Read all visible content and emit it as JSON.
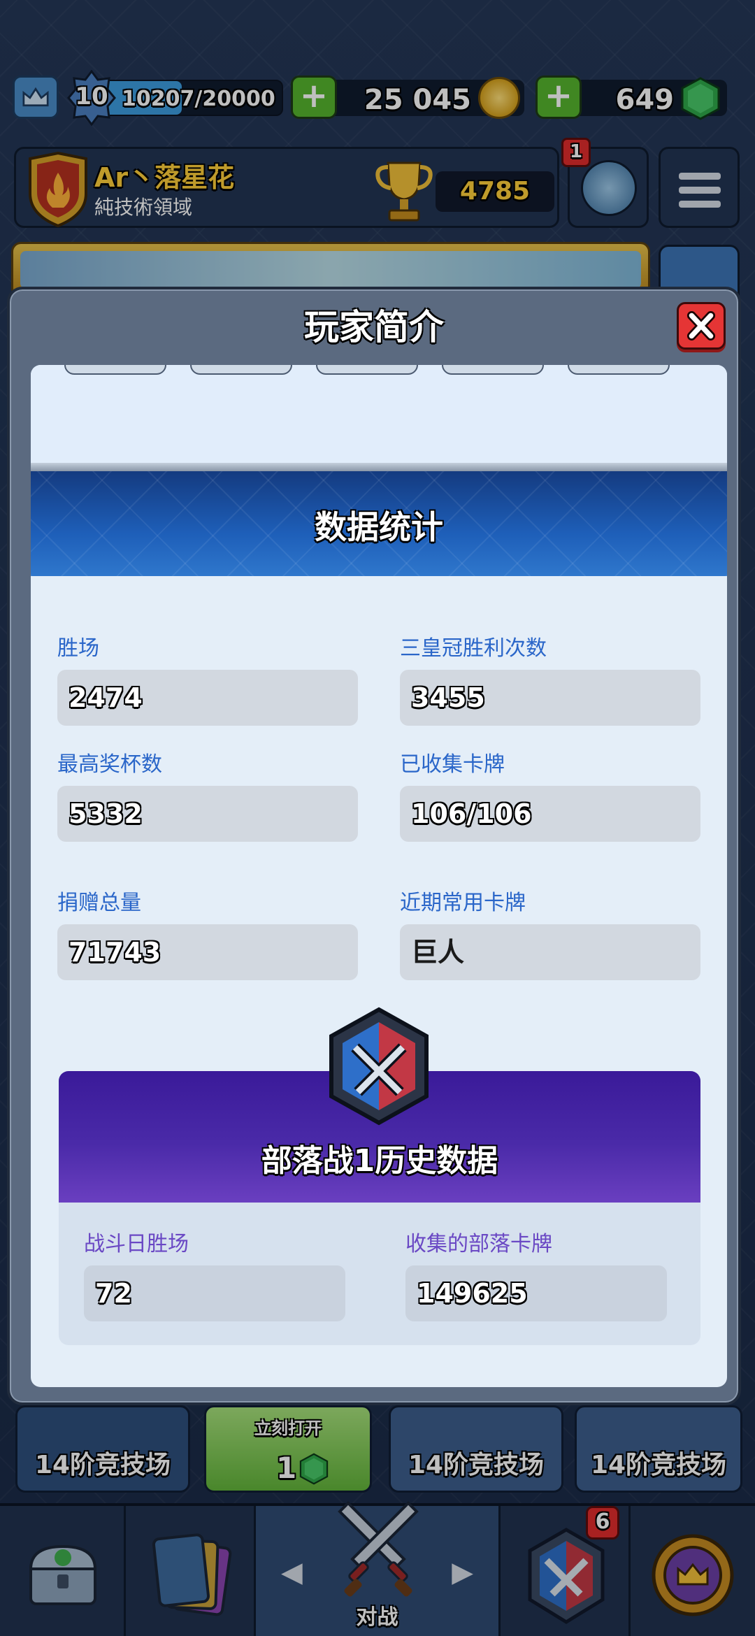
{
  "topbar": {
    "level": "10",
    "xp": "10207/20000",
    "xp_progress": 0.51,
    "gold": "25 045",
    "gems": "649",
    "plus_label": "+"
  },
  "profile": {
    "name_prefix": "Ar丶",
    "name": "落星花",
    "clan": "純技術領域",
    "trophies": "4785",
    "friends_badge": "1"
  },
  "modal": {
    "title": "玩家简介",
    "stats_title": "数据统计",
    "stats": [
      {
        "label": "胜场",
        "value": "2474"
      },
      {
        "label": "三皇冠胜利次数",
        "value": "3455"
      },
      {
        "label": "最高奖杯数",
        "value": "5332"
      },
      {
        "label": "已收集卡牌",
        "value": "106/106"
      },
      {
        "label": "捐赠总量",
        "value": "71743"
      },
      {
        "label": "近期常用卡牌",
        "value": "巨人"
      }
    ],
    "clan_war": {
      "title": "部落战1历史数据",
      "stats": [
        {
          "label": "战斗日胜场",
          "value": "72"
        },
        {
          "label": "收集的部落卡牌",
          "value": "149625"
        }
      ]
    }
  },
  "chests": [
    {
      "label": "14阶竞技场"
    },
    {
      "open_label": "立刻打开",
      "open_cost": "1"
    },
    {
      "label": "14阶竞技场"
    },
    {
      "label": "14阶竞技场"
    }
  ],
  "bottom_nav": {
    "battle_label": "对战",
    "clan_badge": "6"
  },
  "colors": {
    "stat_label": "#2a66c9",
    "war_label": "#6a48c4",
    "close_red": "#e53535",
    "stats_header_blue": "#1e5fb9",
    "war_header_purple": "#4a2aa8"
  }
}
